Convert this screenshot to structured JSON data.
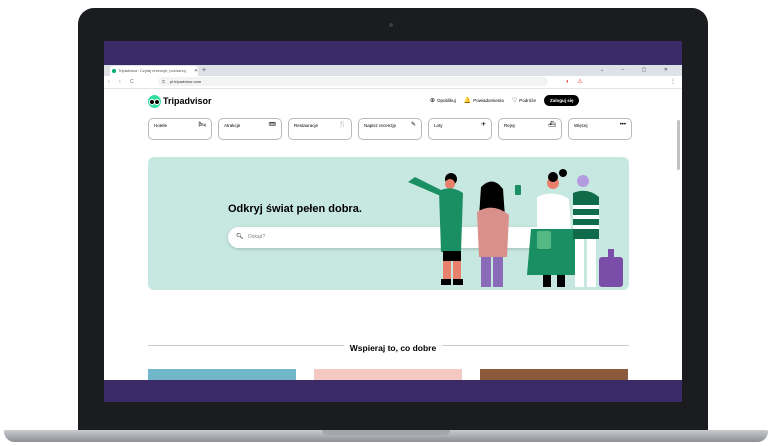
{
  "browser": {
    "tab_title": "Tripadvisor: Czytaj recenzje, porównuj",
    "tab_close_icon": "close-icon",
    "new_tab_symbol": "+",
    "window_controls": "⌄ – ▢ ✕",
    "nav_controls": "‹ › C",
    "url": "pl.tripadvisor.com",
    "menu_symbol": "⋮"
  },
  "header": {
    "logo_text": "Tripadvisor",
    "links": [
      {
        "icon": "⊕",
        "label": "Opublikuj"
      },
      {
        "icon": "🔔",
        "label": "Powiadomienia"
      },
      {
        "icon": "♡",
        "label": "Podróże"
      }
    ],
    "login_label": "Zaloguj się"
  },
  "categories": [
    {
      "label": "Hotele",
      "icon": "bed-icon",
      "glyph": "🛏"
    },
    {
      "label": "Atrakcje",
      "icon": "ticket-icon",
      "glyph": "🎟"
    },
    {
      "label": "Restauracje",
      "icon": "utensils-icon",
      "glyph": "🍴"
    },
    {
      "label": "Napisz recenzję",
      "icon": "edit-icon",
      "glyph": "✎"
    },
    {
      "label": "Loty",
      "icon": "plane-icon",
      "glyph": "✈"
    },
    {
      "label": "Rejsy",
      "icon": "ship-icon",
      "glyph": "⛴"
    },
    {
      "label": "Więcej",
      "icon": "more-icon",
      "glyph": "•••"
    }
  ],
  "hero": {
    "title": "Odkryj świat pełen dobra.",
    "search_placeholder": "Dokąd?"
  },
  "section": {
    "title": "Wspieraj to, co dobre"
  },
  "colors": {
    "brand_green": "#34e0a1",
    "hero_bg": "#c7e8e0",
    "screen_frame": "#3a2a66"
  }
}
